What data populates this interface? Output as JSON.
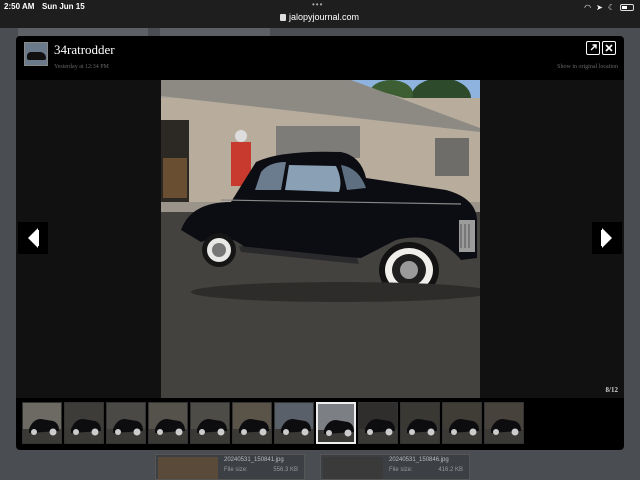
{
  "status_bar": {
    "time": "2:50 AM",
    "date": "Sun Jun 15",
    "url": "jalopyjournal.com"
  },
  "lightbox": {
    "username": "34ratrodder",
    "posted": "Yesterday at 12:34 PM",
    "show_original": "Show in original location",
    "counter": "8/12",
    "open_icon": "external-link-icon",
    "close_icon": "close-icon",
    "prev_icon": "arrow-left-icon",
    "next_icon": "arrow-right-icon"
  },
  "thumbnails": [
    {
      "tone": "#6c6a62"
    },
    {
      "tone": "#3d3c39"
    },
    {
      "tone": "#4a4945"
    },
    {
      "tone": "#55524b"
    },
    {
      "tone": "#4e4c47"
    },
    {
      "tone": "#5a5347"
    },
    {
      "tone": "#59606a"
    },
    {
      "tone": "#7c7f84",
      "active": true
    },
    {
      "tone": "#2f2e2c"
    },
    {
      "tone": "#3a3833"
    },
    {
      "tone": "#403c36"
    },
    {
      "tone": "#47423b"
    }
  ],
  "background_files": [
    {
      "name": "20240531_150841.jpg",
      "label": "File size:",
      "size": "556.3 KB"
    },
    {
      "name": "20240531_150846.jpg",
      "label": "File size:",
      "size": "416.2 KB"
    }
  ]
}
